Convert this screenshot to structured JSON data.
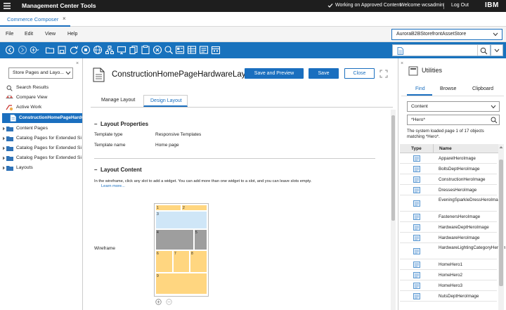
{
  "app": {
    "title": "Management Center Tools",
    "status": "Working on Approved Content",
    "welcome": "Welcome wcsadmin",
    "logout": "Log Out",
    "brand": "IBM"
  },
  "tabs": [
    {
      "label": "Commerce Composer",
      "close": "×"
    }
  ],
  "menu": {
    "items": [
      "File",
      "Edit",
      "View",
      "Help"
    ],
    "store_select": "AuroraB2BStorefrontAssetStore"
  },
  "toolbar": {
    "icons": [
      "back-icon",
      "forward-icon",
      "new-icon",
      "open-icon",
      "save-icon",
      "refresh-icon",
      "stop-icon",
      "globe-icon",
      "tree-icon",
      "preview-icon",
      "copy-icon",
      "paste-icon",
      "clear-icon",
      "search-icon",
      "grid-icon",
      "table-icon",
      "form-icon",
      "calendar-icon"
    ]
  },
  "left": {
    "select": "Store Pages and Layo...",
    "items": [
      {
        "label": "Search Results",
        "icon": "search-icon"
      },
      {
        "label": "Compare View",
        "icon": "compare-icon"
      },
      {
        "label": "Active Work",
        "icon": "active-work-icon"
      },
      {
        "label": "ConstructionHomePageHardw",
        "icon": "page-icon",
        "selected": true
      },
      {
        "label": "Content Pages",
        "icon": "folder-icon"
      },
      {
        "label": "Catalog Pages for Extended Sit",
        "icon": "folder-icon"
      },
      {
        "label": "Catalog Pages for Extended Sit",
        "icon": "folder-icon"
      },
      {
        "label": "Catalog Pages for Extended Sit",
        "icon": "folder-icon"
      },
      {
        "label": "Layouts",
        "icon": "folder-icon"
      }
    ]
  },
  "editor": {
    "title": "ConstructionHomePageHardwareLayout",
    "save_preview": "Save and Preview",
    "save": "Save",
    "close": "Close",
    "tabs": [
      "Manage Layout",
      "Design Layout"
    ],
    "active_tab": 1,
    "props_header": "Layout Properties",
    "template_type_label": "Template type",
    "template_type": "Responsive Templates",
    "template_name_label": "Template name",
    "template_name": "Home page",
    "content_header": "Layout Content",
    "instructions": "In the wireframe, click any slot to add a widget. You can add more than one widget to a slot, and you can leave slots empty.",
    "learn_more": "Learn more...",
    "wireframe_label": "Wireframe",
    "slots": [
      "1",
      "2",
      "3",
      "4",
      "5",
      "6",
      "7",
      "8",
      "9"
    ]
  },
  "utilities": {
    "title": "Utilities",
    "tabs": [
      "Find",
      "Browse",
      "Clipboard"
    ],
    "active_tab": 0,
    "type_select": "Content",
    "search_value": "*Hero*",
    "message": "The system loaded page 1 of 17 objects matching *Hero*.",
    "columns": [
      "Type",
      "Name"
    ],
    "rows": [
      "ApparelHeroImage",
      "BoltsDeptHeroImage",
      "ConstructionHeroImage",
      "DressesHeroImage",
      "EveningSparkleDressHeroImage",
      "FastenersHeroImage",
      "HardwareDeptHeroImage",
      "HardwareHeroImage",
      "HardwareLightingCategoryHeroImage",
      "HomeHero1",
      "HomeHero2",
      "HomeHero3",
      "NutsDeptHeroImage"
    ]
  },
  "colors": {
    "accent": "#1a6fbf",
    "toolbar": "#1872bd",
    "slot_yellow": "#ffd680",
    "slot_blue": "#cfe6f7",
    "slot_gray": "#9e9e9e"
  }
}
